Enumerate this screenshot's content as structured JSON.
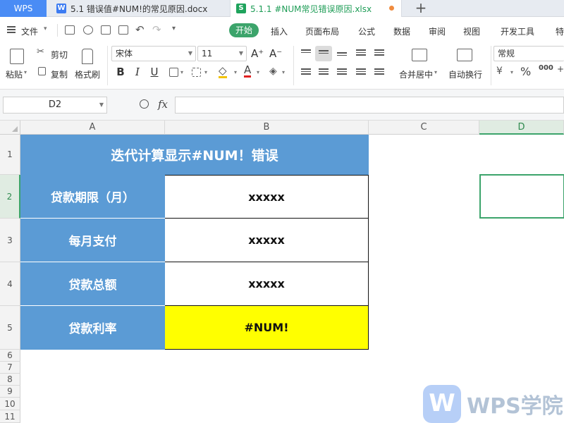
{
  "tabs": {
    "wps": "WPS",
    "doc": "5.1 错误值#NUM!的常见原因.docx",
    "xls": "5.1.1 #NUM常见错误原因.xlsx",
    "add": "+"
  },
  "menu": {
    "file": "文件",
    "items": [
      "开始",
      "插入",
      "页面布局",
      "公式",
      "数据",
      "审阅",
      "视图",
      "开发工具",
      "特"
    ]
  },
  "ribbon": {
    "paste": "粘贴",
    "cut": "剪切",
    "copy": "复制",
    "format_painter": "格式刷",
    "font_name": "宋体",
    "font_size": "11",
    "merge_center": "合并居中",
    "wrap_text": "自动换行",
    "number_format": "常规"
  },
  "formula_bar": {
    "name_box": "D2",
    "fx": "fx",
    "formula": ""
  },
  "columns": [
    "A",
    "B",
    "C",
    "D"
  ],
  "rows": [
    "1",
    "2",
    "3",
    "4",
    "5",
    "6",
    "7",
    "8",
    "9",
    "10",
    "11"
  ],
  "sheet": {
    "title": "迭代计算显示#NUM！错误",
    "table": [
      {
        "label": "贷款期限（月）",
        "value": "xxxxx"
      },
      {
        "label": "每月支付",
        "value": "xxxxx"
      },
      {
        "label": "贷款总额",
        "value": "xxxxx"
      },
      {
        "label": "贷款利率",
        "value": "#NUM!"
      }
    ]
  },
  "watermark": "WPS学院",
  "colors": {
    "header_blue": "#5b9bd5",
    "error_yellow": "#ffff00",
    "accent_green": "#3ca46b"
  }
}
